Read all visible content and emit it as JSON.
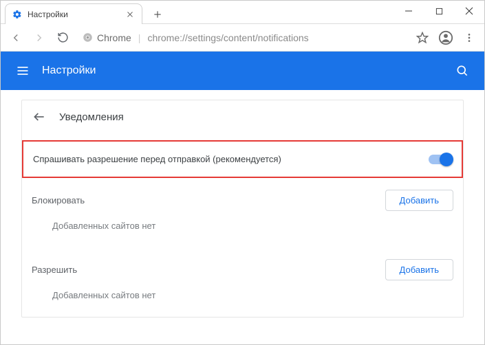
{
  "window": {
    "tab_title": "Настройки"
  },
  "toolbar": {
    "chrome_label": "Chrome",
    "url_path": "chrome://settings/content/notifications"
  },
  "header": {
    "title": "Настройки"
  },
  "page": {
    "back_label": "Уведомления",
    "toggle_label": "Спрашивать разрешение перед отправкой (рекомендуется)",
    "toggle_on": true,
    "sections": [
      {
        "title": "Блокировать",
        "add_label": "Добавить",
        "empty_msg": "Добавленных сайтов нет"
      },
      {
        "title": "Разрешить",
        "add_label": "Добавить",
        "empty_msg": "Добавленных сайтов нет"
      }
    ]
  }
}
